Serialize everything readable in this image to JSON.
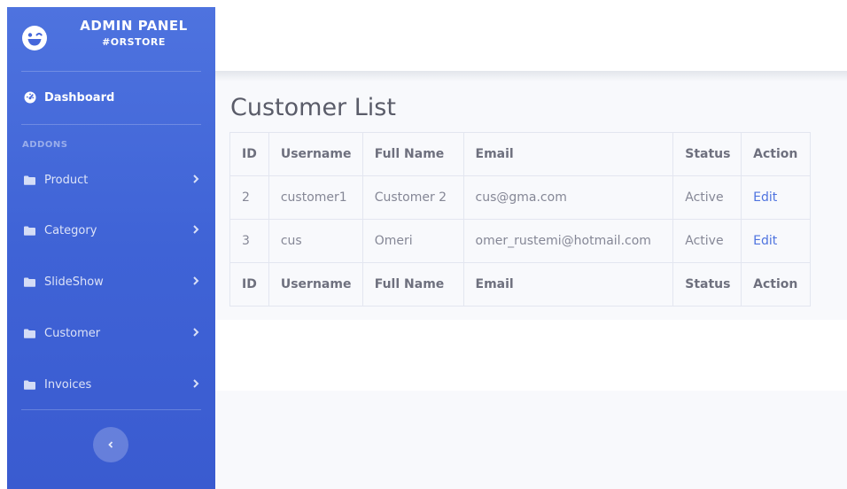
{
  "brand": {
    "title": "ADMIN PANEL",
    "subtitle": "#ORSTORE",
    "icon": "laugh-wink-icon"
  },
  "sidebar": {
    "dashboard": {
      "label": "Dashboard",
      "icon": "tachometer-icon"
    },
    "heading": "ADDONS",
    "items": [
      {
        "label": "Product",
        "icon": "folder-icon"
      },
      {
        "label": "Category",
        "icon": "folder-icon"
      },
      {
        "label": "SlideShow",
        "icon": "folder-icon"
      },
      {
        "label": "Customer",
        "icon": "folder-icon"
      },
      {
        "label": "Invoices",
        "icon": "folder-icon"
      }
    ],
    "toggle_icon": "chevron-left-icon"
  },
  "main": {
    "title": "Customer List",
    "table": {
      "columns": [
        "ID",
        "Username",
        "Full Name",
        "Email",
        "Status",
        "Action"
      ],
      "rows": [
        {
          "id": "2",
          "username": "customer1",
          "full_name": "Customer 2",
          "email": "cus@gma.com",
          "status": "Active",
          "action": "Edit"
        },
        {
          "id": "3",
          "username": "cus",
          "full_name": "Omeri",
          "email": "omer_rustemi@hotmail.com",
          "status": "Active",
          "action": "Edit"
        }
      ],
      "footer": [
        "ID",
        "Username",
        "Full Name",
        "Email",
        "Status",
        "Action"
      ]
    }
  },
  "colors": {
    "sidebar_primary": "#4e73df",
    "sidebar_dark": "#3a5bd0",
    "content_bg": "#f8f9fc",
    "text": "#858796",
    "link": "#4e73df",
    "title": "#5a5c69"
  }
}
